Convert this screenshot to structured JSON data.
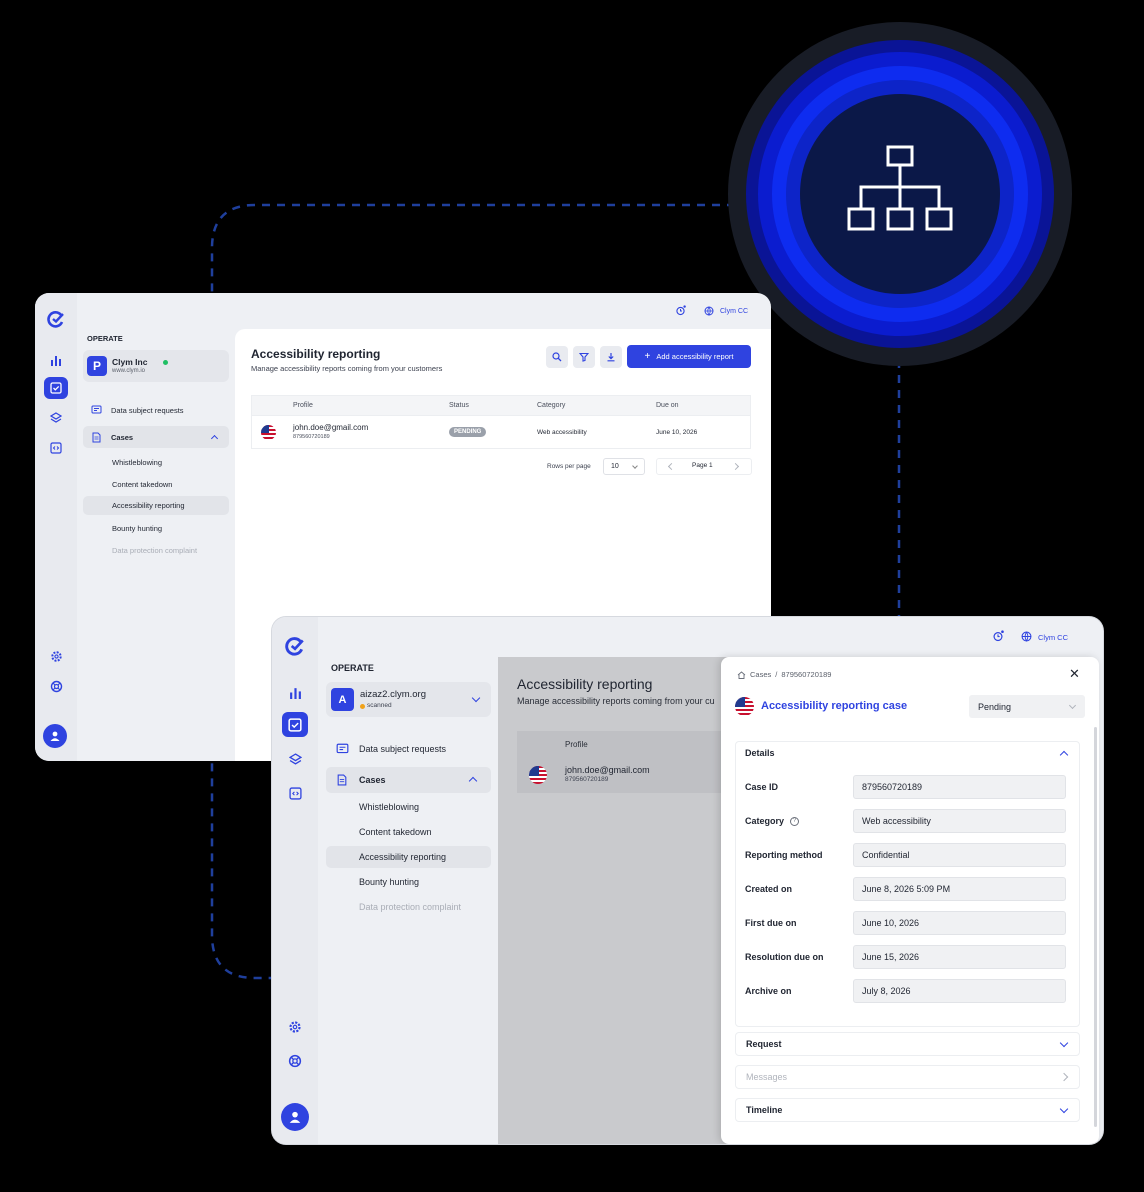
{
  "colors": {
    "accent": "#2f43e0",
    "ring_blue": "#0e2cf0",
    "background": "#000000"
  },
  "badge_icon": "hierarchy-icon",
  "window_back": {
    "topbar": {
      "account": "Clym CC"
    },
    "nav": {
      "section": "OPERATE",
      "org": {
        "initial": "P",
        "name": "Clym Inc",
        "url": "www.clym.io"
      },
      "items": [
        {
          "label": "Data subject requests"
        },
        {
          "label": "Cases"
        },
        {
          "label": "Whistleblowing"
        },
        {
          "label": "Content takedown"
        },
        {
          "label": "Accessibility reporting"
        },
        {
          "label": "Bounty hunting"
        },
        {
          "label": "Data protection complaint"
        }
      ]
    },
    "page": {
      "title": "Accessibility reporting",
      "subtitle": "Manage accessibility reports coming from your customers",
      "add_button": "Add accessibility report",
      "columns": [
        "Profile",
        "Status",
        "Category",
        "Due on"
      ],
      "rows": [
        {
          "email": "john.doe@gmail.com",
          "id": "879560720189",
          "status": "PENDING",
          "category": "Web accessibility",
          "due": "June 10, 2026"
        }
      ],
      "rows_per_page_label": "Rows per page",
      "rows_per_page": "10",
      "page_label": "Page 1"
    }
  },
  "window_front": {
    "topbar": {
      "account": "Clym CC"
    },
    "nav": {
      "section": "OPERATE",
      "org": {
        "initial": "A",
        "name": "aizaz2.clym.org",
        "status": "scanned"
      },
      "items": [
        {
          "label": "Data subject requests"
        },
        {
          "label": "Cases"
        },
        {
          "label": "Whistleblowing"
        },
        {
          "label": "Content takedown"
        },
        {
          "label": "Accessibility reporting"
        },
        {
          "label": "Bounty hunting"
        },
        {
          "label": "Data protection complaint"
        }
      ]
    },
    "page": {
      "title": "Accessibility reporting",
      "subtitle": "Manage accessibility reports coming from your cu",
      "column": "Profile",
      "row": {
        "email": "john.doe@gmail.com",
        "id": "879560720189"
      }
    },
    "drawer": {
      "breadcrumb": {
        "root": "Cases",
        "sep": "/",
        "current": "879560720189"
      },
      "title": "Accessibility reporting case",
      "status": "Pending",
      "details_label": "Details",
      "fields": [
        {
          "label": "Case ID",
          "value": "879560720189"
        },
        {
          "label": "Category",
          "value": "Web accessibility"
        },
        {
          "label": "Reporting method",
          "value": "Confidential"
        },
        {
          "label": "Created on",
          "value": "June 8, 2026 5:09 PM"
        },
        {
          "label": "First due on",
          "value": "June 10, 2026"
        },
        {
          "label": "Resolution due on",
          "value": "June 15, 2026"
        },
        {
          "label": "Archive on",
          "value": "July 8, 2026"
        }
      ],
      "sections": [
        {
          "label": "Request"
        },
        {
          "label": "Messages"
        },
        {
          "label": "Timeline"
        }
      ]
    }
  }
}
